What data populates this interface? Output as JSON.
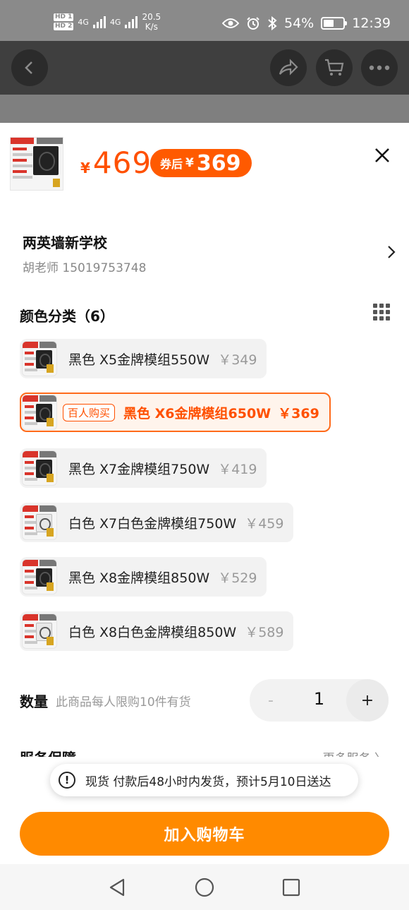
{
  "status_bar": {
    "sim1": "HD 1",
    "sim2": "HD 2",
    "network": "4G",
    "speed_value": "20.5",
    "speed_unit": "K/s",
    "battery_percent": "54%",
    "battery_level": 0.54,
    "time": "12:39",
    "icons": [
      "eye-icon",
      "alarm-icon",
      "bluetooth-icon"
    ]
  },
  "top_nav": {
    "icons": [
      "back-icon",
      "share-icon",
      "cart-icon",
      "more-icon"
    ]
  },
  "product": {
    "currency": "¥",
    "price": "469",
    "coupon_label": "券后",
    "coupon_price": "369"
  },
  "address": {
    "name": "两英墙新学校",
    "contact": "胡老师 15019753748"
  },
  "variants": {
    "title": "颜色分类（6）",
    "items": [
      {
        "name": "黑色 X5金牌模组550W",
        "price": "￥349",
        "color": "black"
      },
      {
        "name": "黑色 X6金牌模组650W",
        "price": "￥369",
        "color": "black",
        "tag": "百人购买",
        "selected": true
      },
      {
        "name": "黑色 X7金牌模组750W",
        "price": "￥419",
        "color": "black"
      },
      {
        "name": "白色 X7白色金牌模组750W",
        "price": "￥459",
        "color": "white"
      },
      {
        "name": "黑色 X8金牌模组850W",
        "price": "￥529",
        "color": "black"
      },
      {
        "name": "白色 X8白色金牌模组850W",
        "price": "￥589",
        "color": "white"
      }
    ]
  },
  "quantity": {
    "label": "数量",
    "note": "此商品每人限购10件有货",
    "value": "1",
    "minus": "-",
    "plus": "+"
  },
  "service": {
    "title": "服务保障",
    "more": "更多服务 〉"
  },
  "delivery": {
    "icon": "!",
    "text": "现货 付款后48小时内发货，预计5月10日送达"
  },
  "cta": {
    "label": "加入购物车"
  },
  "colors": {
    "accent": "#ff5000",
    "cta": "#ff8a00"
  }
}
